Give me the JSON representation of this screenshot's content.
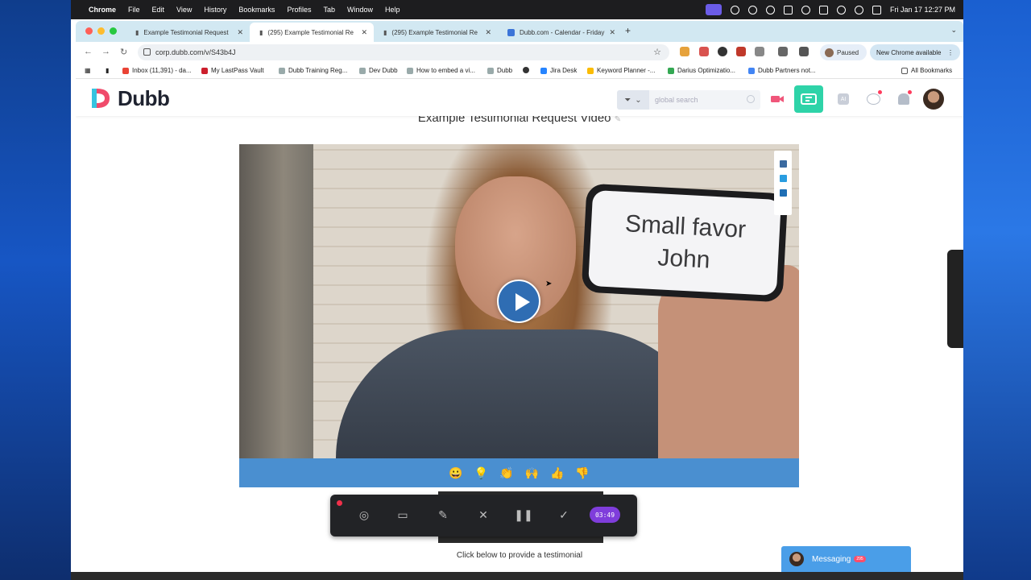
{
  "macos_menubar": {
    "app": "Chrome",
    "items": [
      "File",
      "Edit",
      "View",
      "History",
      "Bookmarks",
      "Profiles",
      "Tab",
      "Window",
      "Help"
    ],
    "clock": "Fri Jan 17  12:27 PM"
  },
  "tabs": [
    {
      "label": "Example Testimonial Request",
      "active": false
    },
    {
      "label": "(295) Example Testimonial Re",
      "active": true
    },
    {
      "label": "(295) Example Testimonial Re",
      "active": false
    },
    {
      "label": "Dubb.com - Calendar - Friday",
      "active": false
    }
  ],
  "address_bar": {
    "url": "corp.dubb.com/v/S43b4J"
  },
  "profile": {
    "status": "Paused"
  },
  "update_button": "New Chrome available",
  "bookmarks": [
    {
      "label": "Inbox (11,391) - da..."
    },
    {
      "label": "My LastPass Vault"
    },
    {
      "label": "Dubb Training Reg..."
    },
    {
      "label": "Dev Dubb"
    },
    {
      "label": "How to embed a vi..."
    },
    {
      "label": "Dubb"
    },
    {
      "label": "Jira Desk"
    },
    {
      "label": "Keyword Planner -..."
    },
    {
      "label": "Darius Optimizatio..."
    },
    {
      "label": "Dubb Partners not..."
    }
  ],
  "all_bookmarks": "All Bookmarks",
  "site": {
    "logo_text": "Dubb",
    "search_placeholder": "global search",
    "ai_label": "AI",
    "page_title": "Example Testimonial Request Video",
    "phone_text_line1": "Small favor",
    "phone_text_line2": "John",
    "reactions": [
      "😀",
      "💡",
      "👏",
      "🙌",
      "👍",
      "👎"
    ],
    "cta_text": "Click below to provide a testimonial",
    "messaging_label": "Messaging",
    "messaging_badge": "295"
  },
  "recorder": {
    "timer": "03:49"
  },
  "colors": {
    "brand_green": "#2ed3a8",
    "reaction_bar": "#4a8fd0",
    "play_button": "#2f6db3",
    "timer_purple": "#7f3ddb",
    "messaging_blue": "#4a9ee8"
  }
}
